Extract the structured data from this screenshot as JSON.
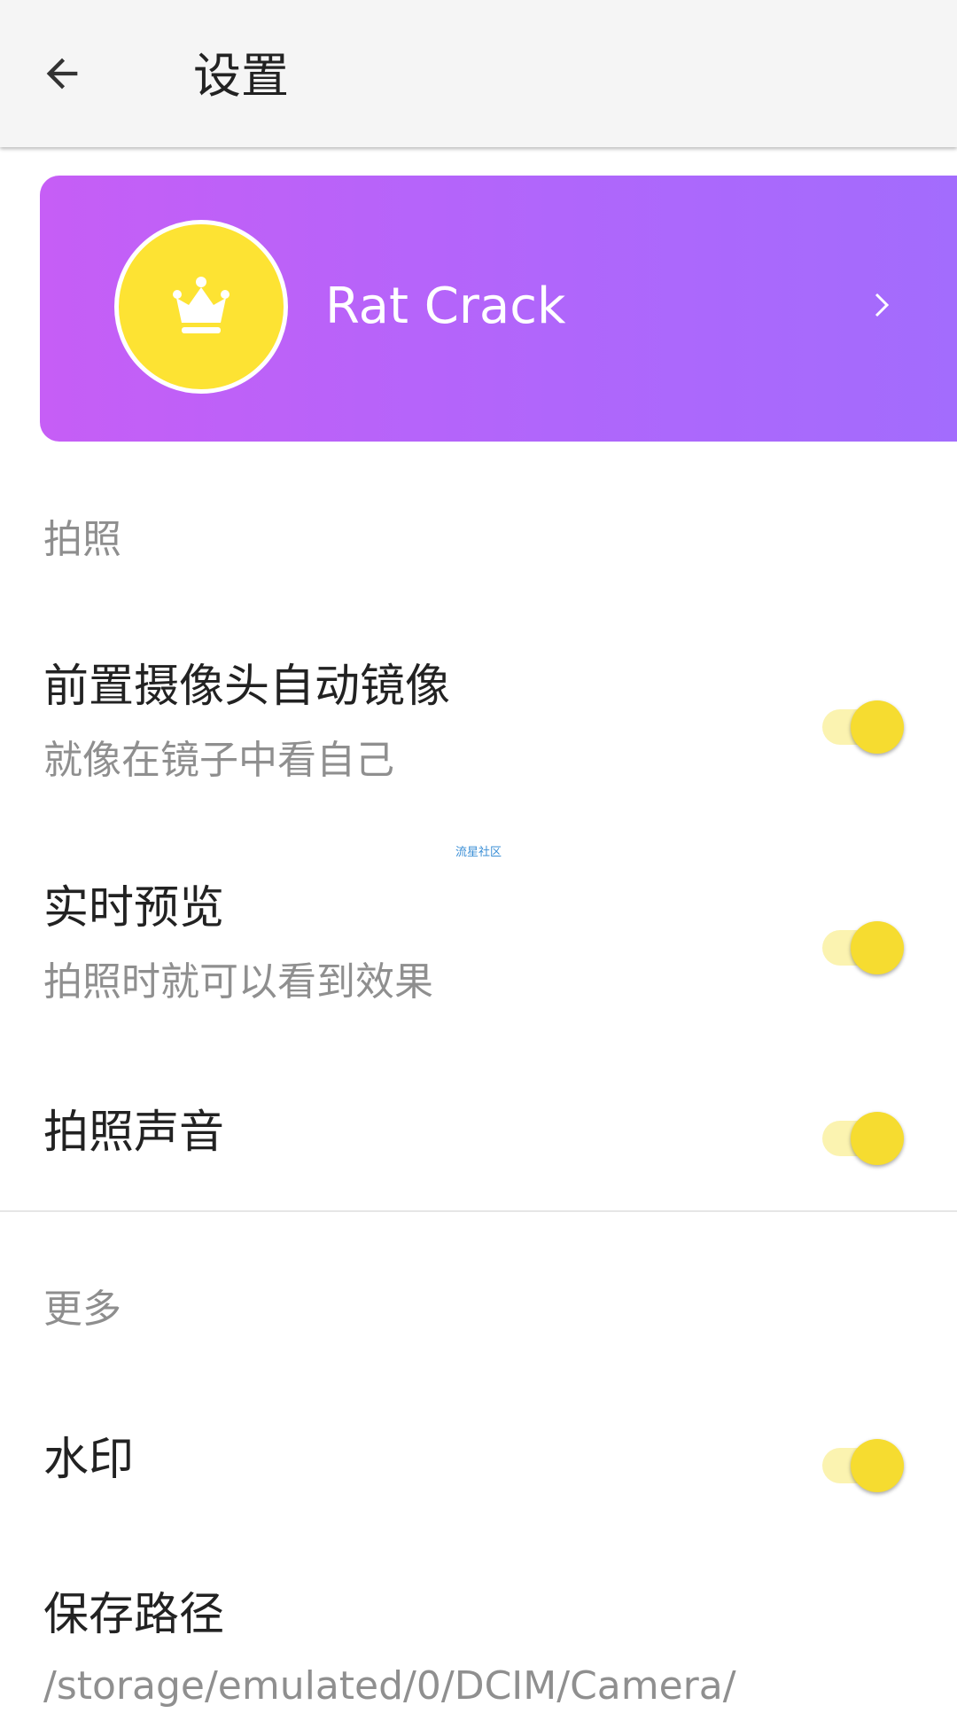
{
  "appbar": {
    "title": "设置",
    "back_icon": "arrow-back-icon"
  },
  "vip_card": {
    "username": "Rat Crack",
    "avatar_icon": "crown-icon",
    "chevron_icon": "chevron-right-icon",
    "colors": {
      "gradient_start": "#c65ef6",
      "gradient_end": "#a26cfd",
      "avatar_bg": "#fde333"
    }
  },
  "sections": [
    {
      "header": "拍照",
      "items": [
        {
          "title": "前置摄像头自动镜像",
          "subtitle": "就像在镜子中看自己",
          "enabled": true
        },
        {
          "title": "实时预览",
          "subtitle": "拍照时就可以看到效果",
          "enabled": true
        },
        {
          "title": "拍照声音",
          "enabled": true
        }
      ]
    },
    {
      "header": "更多",
      "items": [
        {
          "title": "水印",
          "enabled": true
        },
        {
          "title": "保存路径",
          "subtitle": "/storage/emulated/0/DCIM/Camera/"
        }
      ]
    }
  ],
  "watermark_text": "流星社区",
  "accent_color": "#f6dc30"
}
